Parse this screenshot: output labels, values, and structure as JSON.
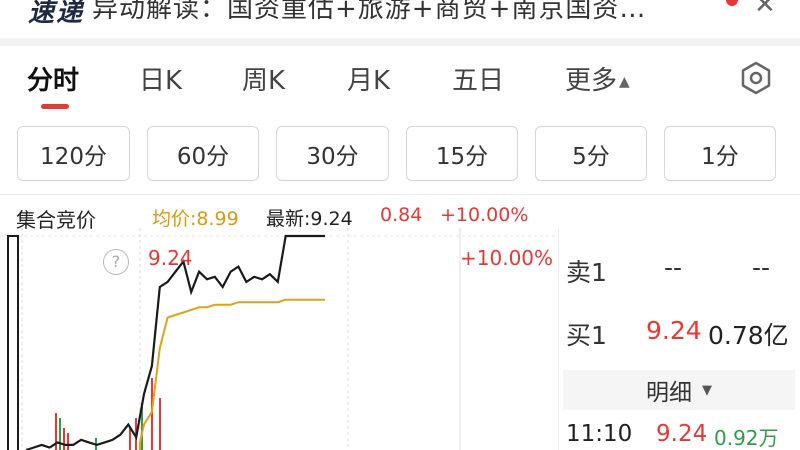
{
  "news": {
    "logo": "速递",
    "headline": "异动解读：国资重估+旅游+商贸+南京国资…",
    "close_icon": "close-icon"
  },
  "tabs": [
    {
      "label": "分时",
      "active": true
    },
    {
      "label": "日K"
    },
    {
      "label": "周K"
    },
    {
      "label": "月K"
    },
    {
      "label": "五日"
    },
    {
      "label": "更多"
    }
  ],
  "minute_buttons": [
    "120分",
    "60分",
    "30分",
    "15分",
    "5分",
    "1分"
  ],
  "info": {
    "label": "集合竞价",
    "avg": "均价:8.99",
    "latest": "最新:9.24",
    "change": "0.84",
    "change_pct": "+10.00%"
  },
  "chart_labels": {
    "top_price": "9.24",
    "top_pct": "+10.00%",
    "help": "?"
  },
  "order_book": {
    "sell1": {
      "label": "卖1",
      "price": "--",
      "volume": "--"
    },
    "buy1": {
      "label": "买1",
      "price": "9.24",
      "volume": "0.78亿"
    }
  },
  "detail": {
    "label": "明细",
    "trades": [
      {
        "time": "11:10",
        "price": "9.24",
        "volume": "0.92万"
      }
    ]
  },
  "colors": {
    "up": "#e53935",
    "avg_line": "#e0a21a",
    "price_line": "#1a1a1a",
    "volume_up": "#e53935",
    "volume_down": "#2e9d48"
  },
  "chart_data": {
    "type": "line",
    "title": "",
    "xlabel": "",
    "ylabel": "",
    "series": [
      {
        "name": "",
        "values": [
          8.4,
          8.41,
          8.42,
          8.41,
          8.43,
          8.42,
          8.42,
          8.44,
          8.43,
          8.42,
          8.43,
          8.44,
          8.46,
          8.5,
          8.45,
          8.62,
          8.73,
          9.04,
          9.06,
          9.1,
          9.14,
          9.02,
          9.1,
          9.07,
          9.08,
          9.04,
          9.1,
          9.12,
          9.06,
          9.08,
          9.07,
          9.09,
          9.06,
          9.24,
          9.24,
          9.24,
          9.24,
          9.24,
          9.24
        ]
      },
      {
        "name": "",
        "values": [
          8.4,
          8.4,
          8.4,
          8.41,
          8.41,
          8.41,
          8.41,
          8.42,
          8.42,
          8.42,
          8.42,
          8.42,
          8.42,
          8.43,
          8.43,
          8.5,
          8.55,
          8.8,
          8.92,
          8.93,
          8.94,
          8.95,
          8.96,
          8.96,
          8.97,
          8.97,
          8.97,
          8.98,
          8.98,
          8.98,
          8.98,
          8.98,
          8.98,
          8.99,
          8.99,
          8.99,
          8.99,
          8.99,
          8.99
        ]
      }
    ],
    "ylim": [
      8.4,
      9.24
    ],
    "grid": true
  }
}
